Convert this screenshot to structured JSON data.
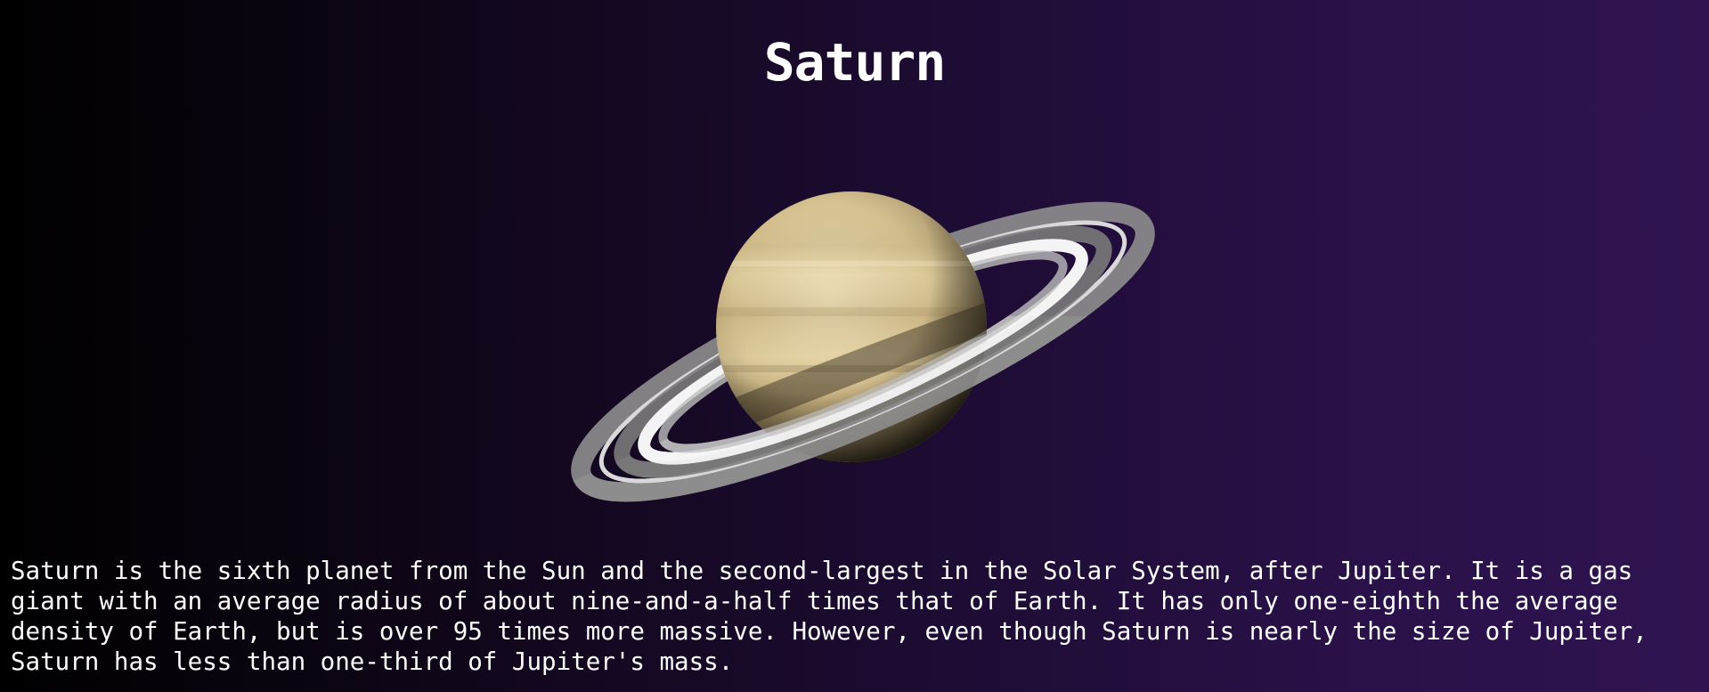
{
  "page": {
    "title": "Saturn",
    "description": "Saturn is the sixth planet from the Sun and the second-largest in the Solar System, after Jupiter. It is a gas giant with an average radius of about nine-and-a-half times that of Earth. It has only one-eighth the average density of Earth, but is over 95 times more massive. However, even though Saturn is nearly the size of Jupiter, Saturn has less than one-third of Jupiter's mass."
  },
  "image": {
    "subject": "saturn-planet-illustration"
  },
  "colors": {
    "background_start": "#000000",
    "background_end": "#2f1451",
    "text": "#ffffff",
    "planet_light": "#ecdcb4",
    "planet_dark": "#8a7a58",
    "ring": "#9a9a9a"
  }
}
